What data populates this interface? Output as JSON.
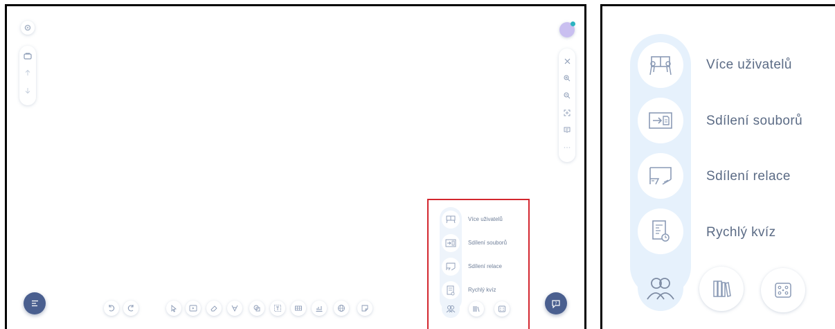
{
  "menu": {
    "items": [
      {
        "label": "Více uživatelů",
        "icon": "multi-user-icon"
      },
      {
        "label": "Sdílení souborů",
        "icon": "file-share-icon"
      },
      {
        "label": "Sdílení relace",
        "icon": "session-share-icon"
      },
      {
        "label": "Rychlý kvíz",
        "icon": "quick-quiz-icon"
      }
    ]
  },
  "toolbar": {
    "tools": [
      "undo-icon",
      "redo-icon",
      "select-icon",
      "media-icon",
      "eraser-icon",
      "pen-icon",
      "shapes-icon",
      "text-icon",
      "table-icon",
      "chart-icon",
      "globe-icon",
      "sticky-note-icon",
      "users-group-icon",
      "library-icon",
      "board-icon"
    ]
  },
  "right_tools": [
    "close-icon",
    "zoom-in-icon",
    "zoom-out-icon",
    "fit-screen-icon",
    "present-icon",
    "more-icon"
  ],
  "colors": {
    "accent": "#4a5f8f",
    "menu_bg": "#e6f1fc",
    "highlight": "#d3262e",
    "icon": "#8a9ab5"
  }
}
